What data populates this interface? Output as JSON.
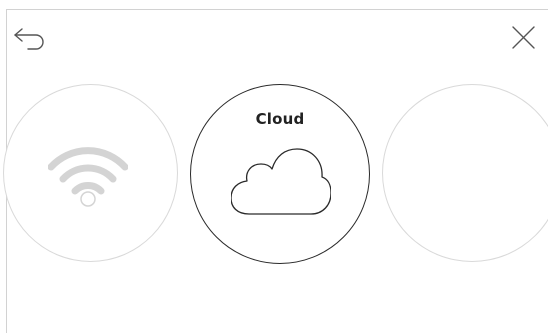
{
  "header": {
    "back_icon": "back-arrow-icon",
    "close_icon": "close-icon"
  },
  "carousel": {
    "items": [
      {
        "icon": "wifi-icon",
        "label": "",
        "state": "inactive"
      },
      {
        "icon": "cloud-icon",
        "label": "Cloud",
        "state": "selected"
      },
      {
        "icon": "",
        "label": "",
        "state": "inactive"
      }
    ]
  },
  "colors": {
    "background": "#ffffff",
    "selected_stroke": "#2a2a2a",
    "inactive_stroke": "#d9d9d9",
    "frame_border": "#d2d2d2"
  }
}
